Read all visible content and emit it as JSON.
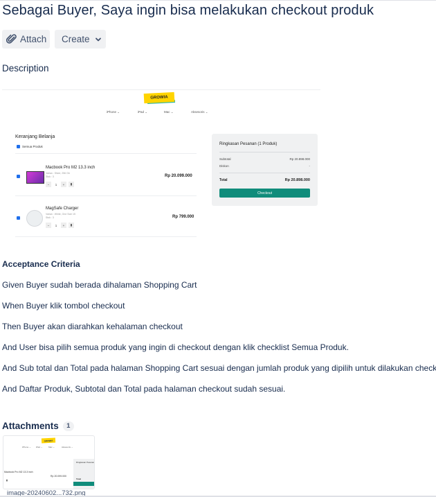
{
  "issue": {
    "title": "Sebagai Buyer, Saya ingin bisa melakukan checkout produk"
  },
  "toolbar": {
    "attach_label": "Attach",
    "attach_icon": "paperclip-icon",
    "create_label": "Create",
    "create_icon": "chevron-down-icon"
  },
  "description": {
    "heading": "Description",
    "screenshot": {
      "logo_text": "GROWIA",
      "nav": [
        "iPhone ⌄",
        "iPad ⌄",
        "Mac ⌄",
        "Aksesoris ⌄"
      ],
      "cart_title": "Keranjang Belanja",
      "select_all": "Semua Produk",
      "products": [
        {
          "name": "Macbook Pro M2 13.3 inch",
          "variant": "Varian : Silver, 256 Gb",
          "stock": "Stok : 3",
          "qty": "1",
          "price": "Rp 20.099.000"
        },
        {
          "name": "MagSafe Charger",
          "variant": "Varian : White, One Size 15",
          "stock": "Stok : 3",
          "qty": "1",
          "price": "Rp 799.000"
        }
      ],
      "summary": {
        "title": "Ringkasan Pesanan (1 Produk)",
        "subtotal_label": "Subtotal",
        "subtotal_value": "Rp 20.898.000",
        "discount_label": "Diskon",
        "discount_value": "-",
        "total_label": "Total",
        "total_value": "Rp 20.898.000",
        "checkout_label": "Checkout"
      }
    }
  },
  "acceptance": {
    "heading": "Acceptance Criteria",
    "lines": [
      "Given Buyer sudah berada dihalaman Shopping Cart",
      "When Buyer klik tombol checkout",
      "Then Buyer akan diarahkan kehalaman checkout",
      "And User bisa pilih semua produk yang ingin di checkout dengan klik checklist Semua Produk.",
      "And Sub total dan Total pada halaman Shopping Cart sesuai dengan jumlah produk yang dipilih untuk dilakukan checkout.",
      "And Daftar Produk, Subtotal dan Total pada halaman checkout sudah sesuai."
    ]
  },
  "attachments": {
    "heading": "Attachments",
    "count": "1",
    "files": [
      {
        "filename": "image-20240602...732.png"
      }
    ]
  },
  "colors": {
    "text": "#172b4d",
    "button_bg": "#f0f1f3",
    "checkout_green": "#108c7b",
    "logo_yellow": "#ffd400"
  }
}
